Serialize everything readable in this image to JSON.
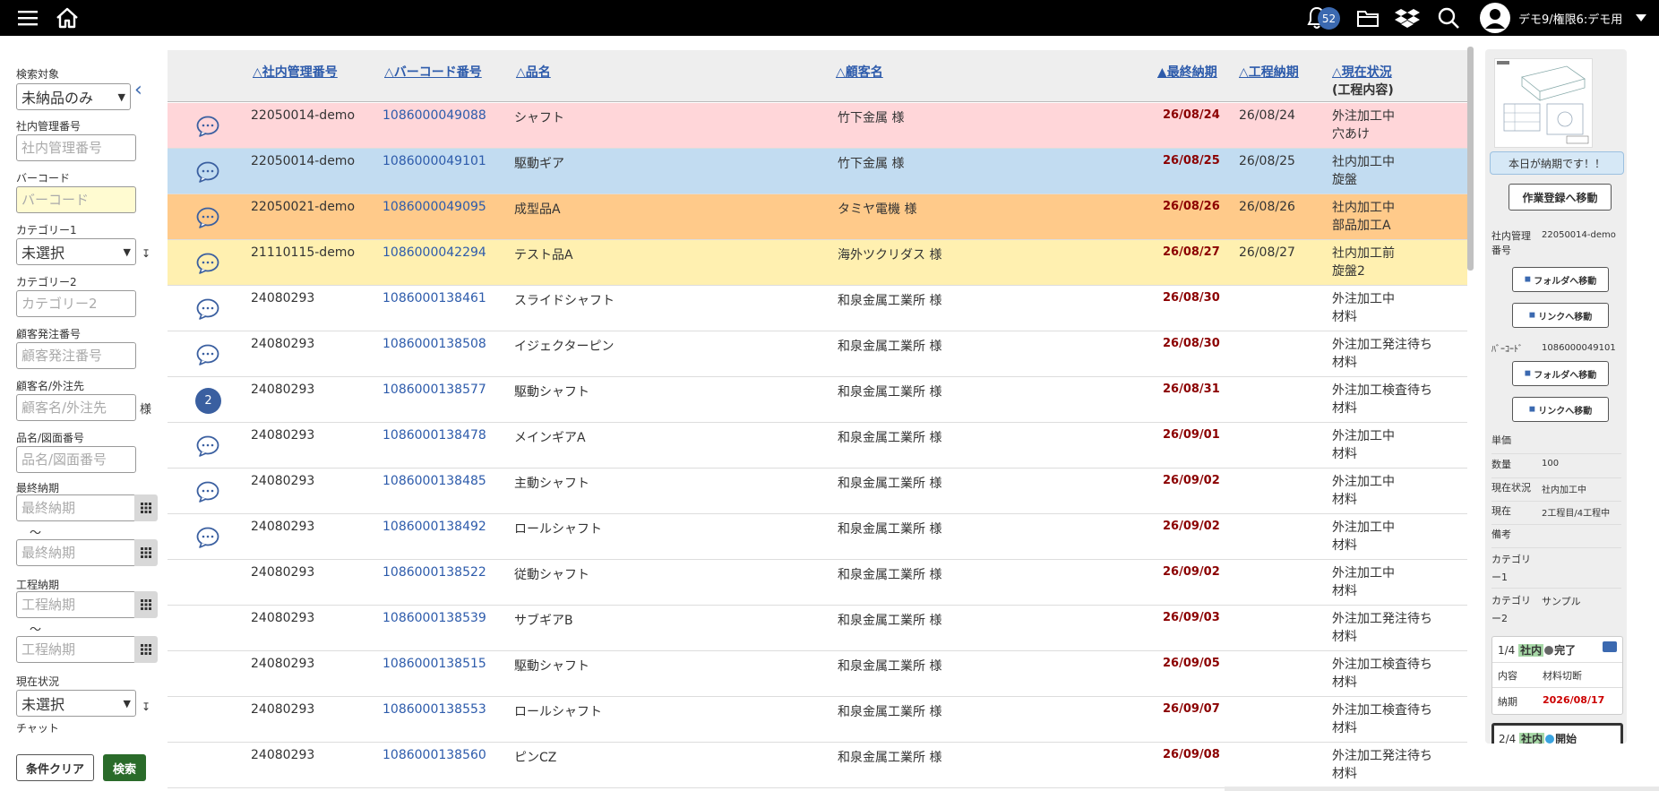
{
  "topbar": {
    "notification_count": "52",
    "user_name": "デモ9/権限6:デモ用"
  },
  "sidebar": {
    "target_label": "検索対象",
    "target_value": "未納品のみ",
    "mgmt_label": "社内管理番号",
    "mgmt_placeholder": "社内管理番号",
    "barcode_label": "バーコード",
    "barcode_placeholder": "バーコード",
    "cat1_label": "カテゴリー1",
    "cat1_value": "未選択",
    "cat2_label": "カテゴリー2",
    "cat2_placeholder": "カテゴリー2",
    "order_label": "顧客発注番号",
    "order_placeholder": "顧客発注番号",
    "customer_label": "顧客名/外注先",
    "customer_placeholder": "顧客名/外注先",
    "customer_suffix": "様",
    "item_label": "品名/図面番号",
    "item_placeholder": "品名/図面番号",
    "final_label": "最終納期",
    "final_placeholder": "最終納期",
    "tilde": "～",
    "proc_label": "工程納期",
    "proc_placeholder": "工程納期",
    "status_label": "現在状況",
    "status_value": "未選択",
    "chat_label": "チャット",
    "clear_label": "条件クリア",
    "search_label": "検索"
  },
  "table": {
    "headers": {
      "mgmt": "△社内管理番号",
      "barcode": "△バーコード番号",
      "name": "△品名",
      "customer": "△顧客名",
      "final": "▲最終納期",
      "proc": "△工程納期",
      "status": "△現在状況",
      "status_sub": "(工程内容)"
    },
    "rows": [
      {
        "chat": "icon",
        "mgmt": "22050014-demo",
        "barcode": "1086000049088",
        "name": "シャフト",
        "customer": "竹下金属 様",
        "final": "26/08/24",
        "proc": "26/08/24",
        "status1": "外注加工中",
        "status2": "穴あけ",
        "bg": "#ffd6d9"
      },
      {
        "chat": "icon",
        "mgmt": "22050014-demo",
        "barcode": "1086000049101",
        "name": "駆動ギア",
        "customer": "竹下金属 様",
        "final": "26/08/25",
        "proc": "26/08/25",
        "status1": "社内加工中",
        "status2": "旋盤",
        "bg": "#c2dcf1"
      },
      {
        "chat": "icon",
        "mgmt": "22050021-demo",
        "barcode": "1086000049095",
        "name": "成型品A",
        "customer": "タミヤ電機 様",
        "final": "26/08/26",
        "proc": "26/08/26",
        "status1": "社内加工中",
        "status2": "部品加工A",
        "bg": "#ffca8a"
      },
      {
        "chat": "icon",
        "mgmt": "21110115-demo",
        "barcode": "1086000042294",
        "name": "テスト品A",
        "customer": "海外ツクリダス 様",
        "final": "26/08/27",
        "proc": "26/08/27",
        "status1": "社内加工前",
        "status2": "旋盤2",
        "bg": "#fff0b0"
      },
      {
        "chat": "icon",
        "mgmt": "24080293",
        "barcode": "1086000138461",
        "name": "スライドシャフト",
        "customer": "和泉金属工業所 様",
        "final": "26/08/30",
        "proc": "",
        "status1": "外注加工中",
        "status2": "材料",
        "bg": "#ffffff"
      },
      {
        "chat": "icon",
        "mgmt": "24080293",
        "barcode": "1086000138508",
        "name": "イジェクターピン",
        "customer": "和泉金属工業所 様",
        "final": "26/08/30",
        "proc": "",
        "status1": "外注加工発注待ち",
        "status2": "材料",
        "bg": "#ffffff"
      },
      {
        "chat": "2",
        "mgmt": "24080293",
        "barcode": "1086000138577",
        "name": "駆動シャフト",
        "customer": "和泉金属工業所 様",
        "final": "26/08/31",
        "proc": "",
        "status1": "外注加工検査待ち",
        "status2": "材料",
        "bg": "#ffffff"
      },
      {
        "chat": "icon",
        "mgmt": "24080293",
        "barcode": "1086000138478",
        "name": "メインギアA",
        "customer": "和泉金属工業所 様",
        "final": "26/09/01",
        "proc": "",
        "status1": "外注加工中",
        "status2": "材料",
        "bg": "#ffffff"
      },
      {
        "chat": "icon",
        "mgmt": "24080293",
        "barcode": "1086000138485",
        "name": "主動シャフト",
        "customer": "和泉金属工業所 様",
        "final": "26/09/02",
        "proc": "",
        "status1": "外注加工中",
        "status2": "材料",
        "bg": "#ffffff"
      },
      {
        "chat": "icon",
        "mgmt": "24080293",
        "barcode": "1086000138492",
        "name": "ロールシャフト",
        "customer": "和泉金属工業所 様",
        "final": "26/09/02",
        "proc": "",
        "status1": "外注加工中",
        "status2": "材料",
        "bg": "#ffffff"
      },
      {
        "chat": "",
        "mgmt": "24080293",
        "barcode": "1086000138522",
        "name": "従動シャフト",
        "customer": "和泉金属工業所 様",
        "final": "26/09/02",
        "proc": "",
        "status1": "外注加工中",
        "status2": "材料",
        "bg": "#ffffff"
      },
      {
        "chat": "",
        "mgmt": "24080293",
        "barcode": "1086000138539",
        "name": "サブギアB",
        "customer": "和泉金属工業所 様",
        "final": "26/09/03",
        "proc": "",
        "status1": "外注加工発注待ち",
        "status2": "材料",
        "bg": "#ffffff"
      },
      {
        "chat": "",
        "mgmt": "24080293",
        "barcode": "1086000138515",
        "name": "駆動シャフト",
        "customer": "和泉金属工業所 様",
        "final": "26/09/05",
        "proc": "",
        "status1": "外注加工検査待ち",
        "status2": "材料",
        "bg": "#ffffff"
      },
      {
        "chat": "",
        "mgmt": "24080293",
        "barcode": "1086000138553",
        "name": "ロールシャフト",
        "customer": "和泉金属工業所 様",
        "final": "26/09/07",
        "proc": "",
        "status1": "外注加工検査待ち",
        "status2": "材料",
        "bg": "#ffffff"
      },
      {
        "chat": "",
        "mgmt": "24080293",
        "barcode": "1086000138560",
        "name": "ピンCZ",
        "customer": "和泉金属工業所 様",
        "final": "26/09/08",
        "proc": "",
        "status1": "外注加工発注待ち",
        "status2": "材料",
        "bg": "#ffffff"
      }
    ]
  },
  "detail": {
    "today_notice": "本日が納期です！！",
    "work_button": "作業登録へ移動",
    "mgmt_key": "社内管理番号",
    "mgmt_val": "22050014-demo",
    "folder_button": "フォルダへ移動",
    "link_button": "リンクへ移動",
    "barcode_key": "ﾊﾞｰｺｰﾄﾞ",
    "barcode_val": "1086000049101",
    "price_key": "単価",
    "qty_key": "数量",
    "qty_val": "100",
    "status_key": "現在状況",
    "status_val": "社内加工中",
    "current_key": "現在",
    "current_val": "2工程目/4工程中",
    "note_key": "備考",
    "cat1_key": "カテゴリー1",
    "cat2_key": "カテゴリー2",
    "cat2_val": "サンプル",
    "step1": {
      "num": "1/4",
      "tag": "社内",
      "state": "完了",
      "content_key": "内容",
      "content_val": "材料切断",
      "due_key": "納期",
      "due_val": "2026/08/17"
    },
    "step2": {
      "num": "2/4",
      "tag": "社内",
      "state": "開始"
    }
  },
  "colors": {
    "accent": "#2d5bab",
    "danger": "#8b0000",
    "search": "#2a6b2a"
  }
}
